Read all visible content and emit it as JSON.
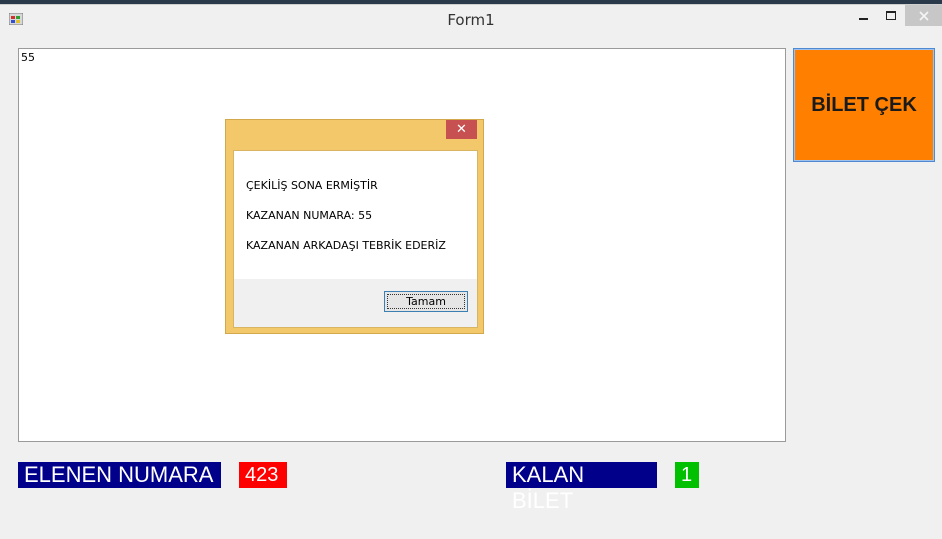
{
  "window": {
    "title": "Form1"
  },
  "main": {
    "textbox_value": "55",
    "draw_button_label": "BİLET ÇEK",
    "eliminated_label": "ELENEN NUMARA",
    "eliminated_value": "423",
    "remaining_label": "KALAN BİLET",
    "remaining_value": "1"
  },
  "dialog": {
    "close_glyph": "✕",
    "line1": "ÇEKİLİŞ SONA ERMİŞTİR",
    "line2": "KAZANAN NUMARA: 55",
    "line3": "KAZANAN ARKADAŞI TEBRİK EDERİZ",
    "ok_label": "Tamam"
  },
  "colors": {
    "draw_button": "#ff8000",
    "label_background": "#00008b",
    "eliminated_value_bg": "#ff0000",
    "remaining_value_bg": "#00c000",
    "dialog_frame": "#f2c86b",
    "dialog_close": "#c75050"
  },
  "icons": {
    "app": "app-icon",
    "minimize": "minimize-icon",
    "maximize": "maximize-icon",
    "close": "close-icon"
  }
}
